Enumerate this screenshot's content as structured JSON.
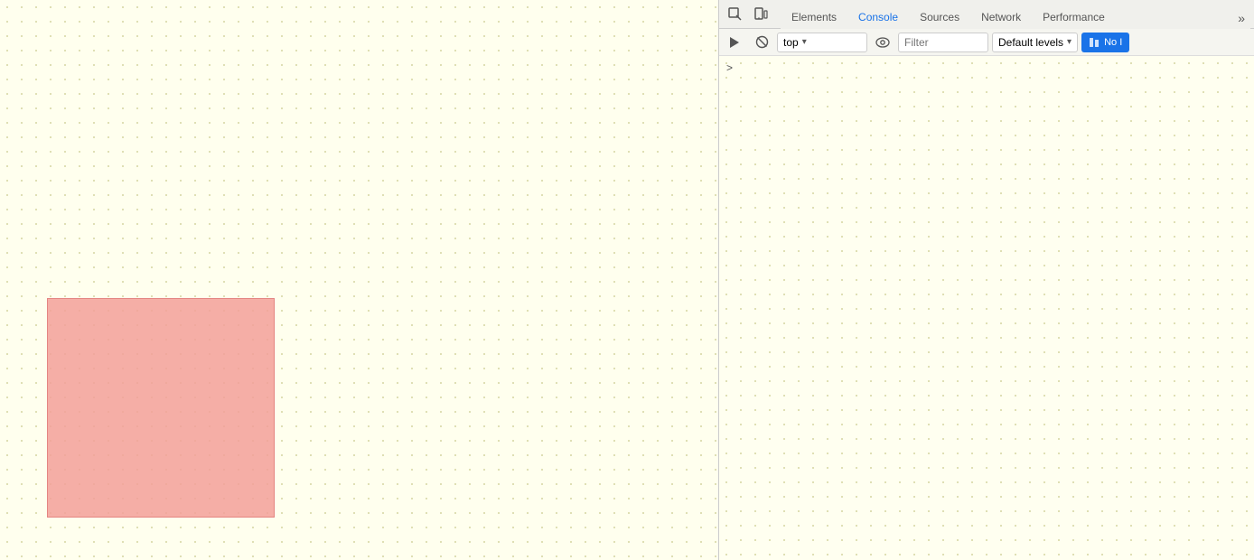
{
  "page": {
    "background_color": "#ffffee",
    "pink_box": {
      "color": "#f4a09a"
    }
  },
  "devtools": {
    "toolbar_top": {
      "inspect_icon": "⬚",
      "device_icon": "⬜"
    },
    "tabs": [
      {
        "id": "elements",
        "label": "Elements",
        "active": false
      },
      {
        "id": "console",
        "label": "Console",
        "active": true
      },
      {
        "id": "sources",
        "label": "Sources",
        "active": false
      },
      {
        "id": "network",
        "label": "Network",
        "active": false
      },
      {
        "id": "performance",
        "label": "Performance",
        "active": false
      }
    ],
    "more_tabs_icon": "»",
    "secondary_toolbar": {
      "run_icon": "▶",
      "clear_icon": "⊘",
      "context_value": "top",
      "context_dropdown": "▾",
      "eye_icon": "👁",
      "filter_placeholder": "Filter",
      "levels_label": "Default levels",
      "levels_dropdown": "▾",
      "no_issues_label": "No I"
    },
    "console_prompt": ">"
  }
}
